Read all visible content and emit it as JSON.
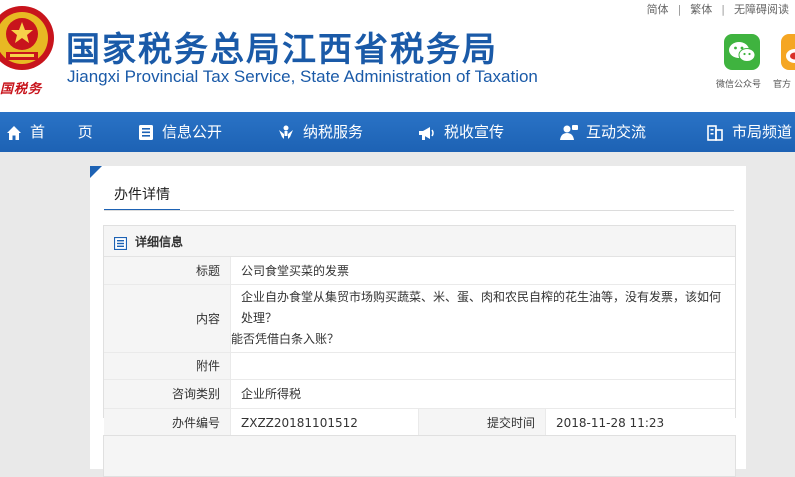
{
  "header": {
    "title_cn": "国家税务总局江西省税务局",
    "title_en": "Jiangxi Provincial Tax Service, State Administration of Taxation",
    "emblem_caption": "国税务",
    "top_links": [
      "简体",
      "繁体",
      "无障碍阅读"
    ],
    "wechat_label": "微信公众号",
    "weibo_label": "官方"
  },
  "nav": {
    "items": [
      {
        "label": "首 页",
        "icon": "home-icon"
      },
      {
        "label": "信息公开",
        "icon": "document-list-icon"
      },
      {
        "label": "纳税服务",
        "icon": "hands-service-icon"
      },
      {
        "label": "税收宣传",
        "icon": "megaphone-icon"
      },
      {
        "label": "互动交流",
        "icon": "user-chat-icon"
      },
      {
        "label": "市局频道",
        "icon": "building-icon"
      }
    ]
  },
  "page": {
    "heading": "办件详情",
    "section_title": "详细信息"
  },
  "detail": {
    "title_label": "标题",
    "title_value": "公司食堂买菜的发票",
    "content_label": "内容",
    "content_value_line1": "企业自办食堂从集贸市场购买蔬菜、米、蛋、肉和农民自榨的花生油等，没有发票，该如何处理？",
    "content_value_line2": "能否凭借白条入账？",
    "attachment_label": "附件",
    "attachment_value": "",
    "category_label": "咨询类别",
    "category_value": "企业所得税",
    "number_label": "办件编号",
    "number_value": "ZXZZ20181101512",
    "submit_label": "提交时间",
    "submit_value": "2018-11-28 11:23"
  },
  "colors": {
    "brand_blue": "#1d62b4",
    "title_blue": "#1a5aa8",
    "emblem_red": "#c8141c",
    "wechat_green": "#3fb33f",
    "weibo_orange": "#f5a623"
  }
}
